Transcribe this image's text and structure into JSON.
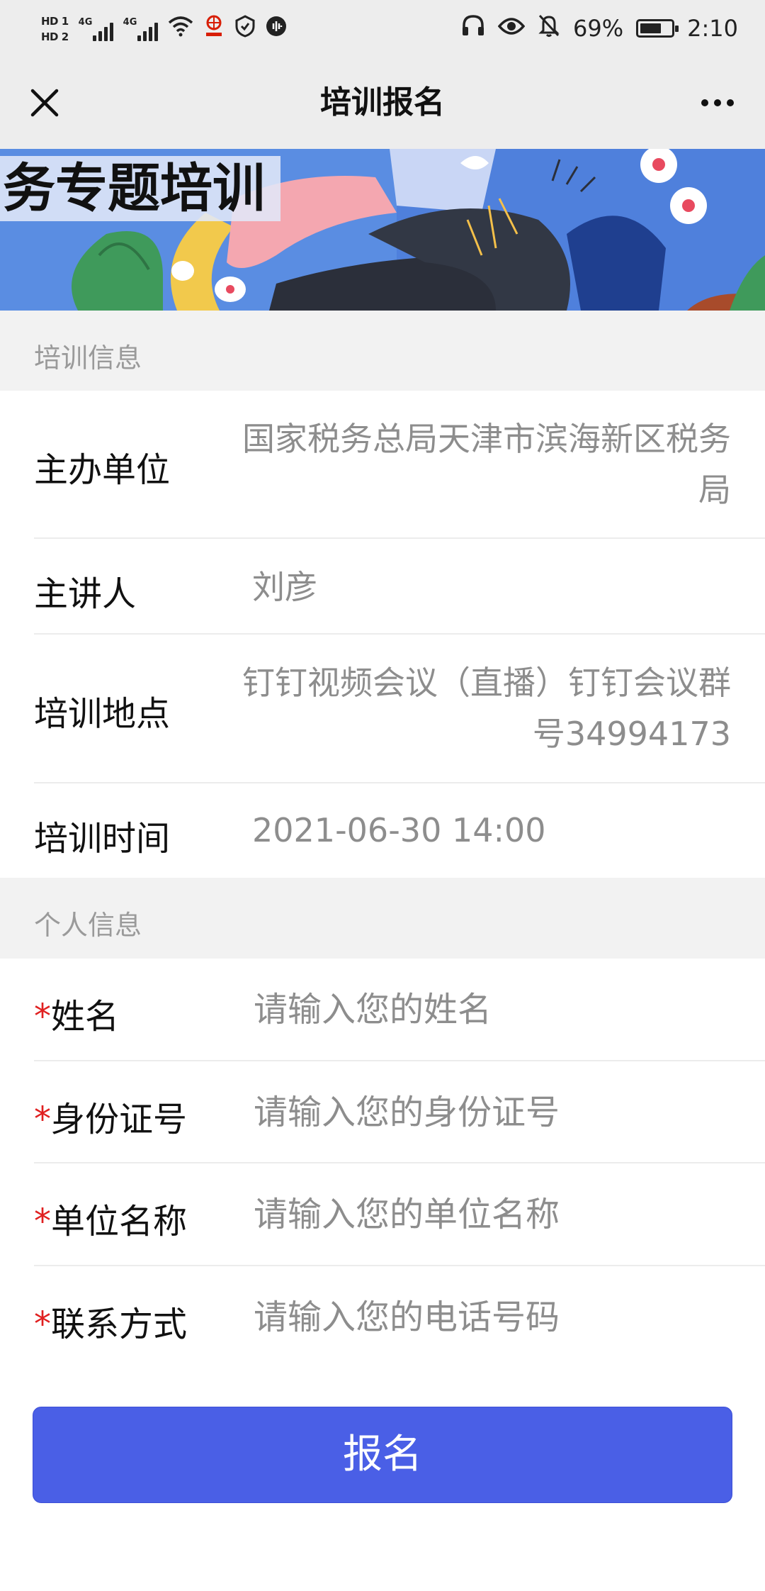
{
  "status_bar": {
    "hd1": "HD 1",
    "hd2": "HD 2",
    "net1": "4G",
    "net2": "4G",
    "battery_pct": "69%",
    "battery_level": 0.69,
    "time": "2:10",
    "icons": [
      "wifi-icon",
      "unicom-logo-icon",
      "shield-icon",
      "voice-icon",
      "headset-icon",
      "eye-icon",
      "bell-off-icon"
    ]
  },
  "nav": {
    "title": "培训报名",
    "close_icon": "close-icon",
    "more_icon": "more-icon"
  },
  "banner": {
    "title": "务专题培训"
  },
  "training_info": {
    "header": "培训信息",
    "organizer_label": "主办单位",
    "organizer_value": "国家税务总局天津市滨海新区税务局",
    "speaker_label": "主讲人",
    "speaker_value": "刘彦",
    "location_label": "培训地点",
    "location_value": "钉钉视频会议（直播）钉钉会议群号34994173",
    "time_label": "培训时间",
    "time_value": "2021-06-30 14:00"
  },
  "personal_info": {
    "header": "个人信息",
    "required_mark": "*",
    "name_label": "姓名",
    "name_placeholder": "请输入您的姓名",
    "id_label": "身份证号",
    "id_placeholder": "请输入您的身份证号",
    "unit_label": "单位名称",
    "unit_placeholder": "请输入您的单位名称",
    "phone_label": "联系方式",
    "phone_placeholder": "请输入您的电话号码"
  },
  "submit_label": "报名",
  "colors": {
    "accent": "#4a5fe6",
    "required": "#e02020",
    "section_bg": "#f2f2f2",
    "nav_bg": "#ededed"
  }
}
